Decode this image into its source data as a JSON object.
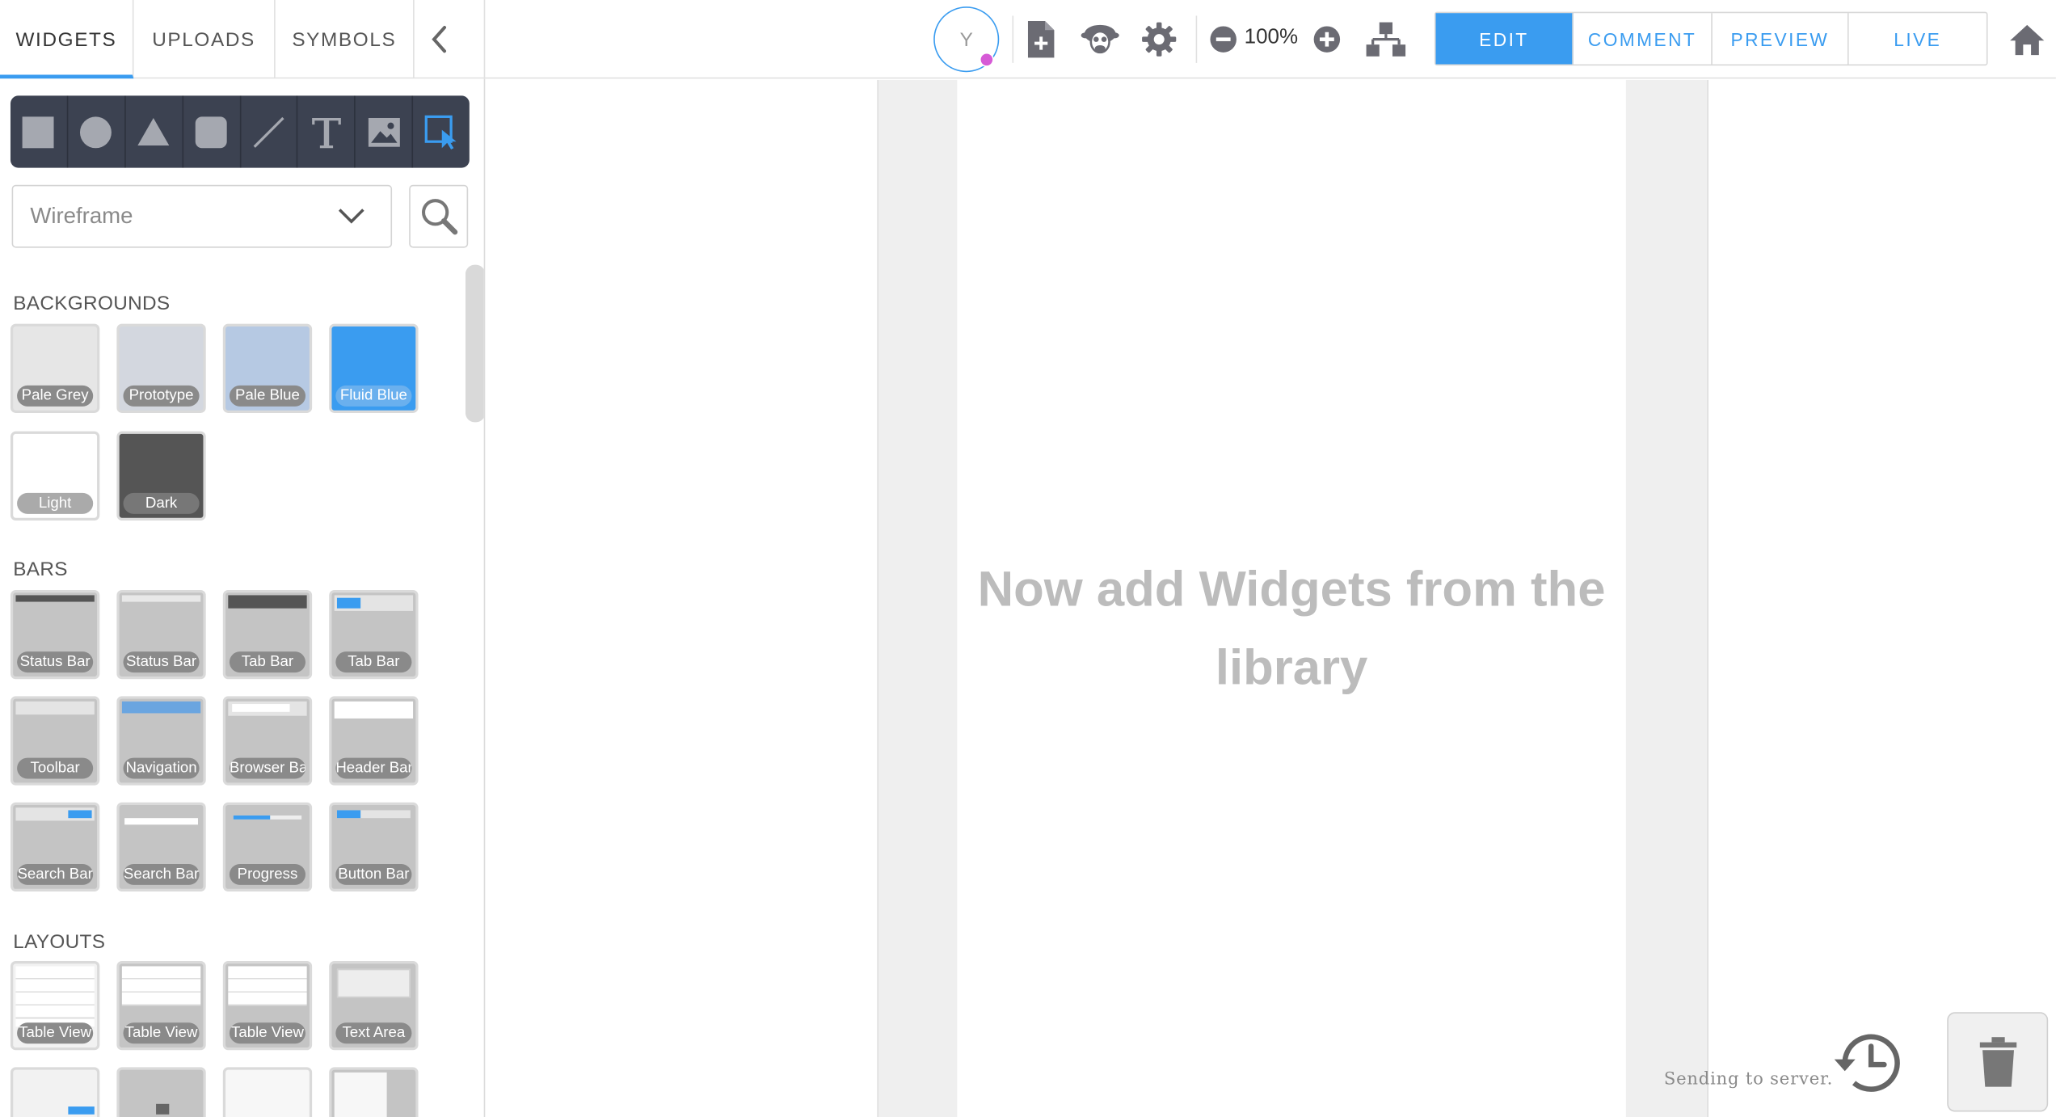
{
  "library_tabs": [
    {
      "label": "WIDGETS",
      "active": true
    },
    {
      "label": "UPLOADS",
      "active": false
    },
    {
      "label": "SYMBOLS",
      "active": false
    }
  ],
  "toolbar": {
    "avatar_initial": "Y",
    "zoom_level": "100%",
    "icons": [
      "new-screen-icon",
      "sheep-icon",
      "gear-icon",
      "zoom-out-icon",
      "zoom-in-icon",
      "sitemap-icon",
      "home-icon"
    ]
  },
  "modes": [
    {
      "label": "EDIT",
      "active": true
    },
    {
      "label": "COMMENT",
      "active": false
    },
    {
      "label": "PREVIEW",
      "active": false
    },
    {
      "label": "LIVE",
      "active": false
    }
  ],
  "shape_tools": [
    "rectangle-icon",
    "circle-icon",
    "triangle-icon",
    "rounded-rect-icon",
    "line-icon",
    "text-icon",
    "image-icon",
    "hotspot-icon"
  ],
  "library_select": {
    "value": "Wireframe"
  },
  "sections": {
    "backgrounds": "BACKGROUNDS",
    "bars": "BARS",
    "layouts": "LAYOUTS"
  },
  "widgets": {
    "backgrounds": [
      "Pale Grey",
      "Prototype",
      "Pale Blue",
      "Fluid Blue",
      "Light",
      "Dark"
    ],
    "bars": [
      "Status Bar",
      "Status Bar",
      "Tab Bar",
      "Tab Bar",
      "Toolbar",
      "Navigation",
      "Browser Bar",
      "Header Bar",
      "Search Bar",
      "Search Bar",
      "Progress",
      "Button Bar"
    ],
    "layouts": [
      "Table View",
      "Table View",
      "Table View",
      "Text Area"
    ]
  },
  "colors": {
    "accent": "#3a9cf0",
    "pale_grey": "#e6e6e6",
    "prototype": "#d3d7df",
    "pale_blue": "#b6c9e3",
    "fluid_blue": "#3a9cf0",
    "light": "#ffffff",
    "dark": "#555555"
  },
  "canvas": {
    "placeholder_line1": "Now add Widgets from the",
    "placeholder_line2": "library"
  },
  "status": {
    "text": "Sending to server."
  }
}
